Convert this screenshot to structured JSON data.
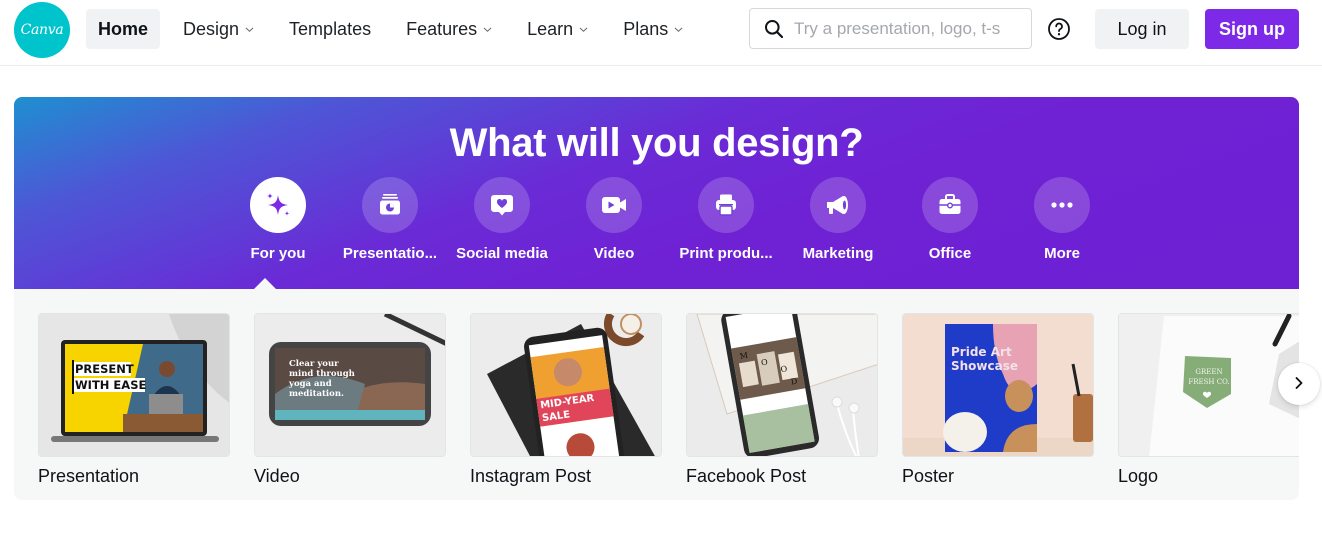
{
  "header": {
    "logo_text": "Canva",
    "nav": [
      {
        "label": "Home",
        "active": true,
        "dropdown": false
      },
      {
        "label": "Design",
        "active": false,
        "dropdown": true
      },
      {
        "label": "Templates",
        "active": false,
        "dropdown": false
      },
      {
        "label": "Features",
        "active": false,
        "dropdown": true
      },
      {
        "label": "Learn",
        "active": false,
        "dropdown": true
      },
      {
        "label": "Plans",
        "active": false,
        "dropdown": true
      }
    ],
    "search": {
      "placeholder": "Try a presentation, logo, t-s",
      "value": "",
      "icon": "search-icon"
    },
    "help_icon": "help-circle-icon",
    "login_label": "Log in",
    "signup_label": "Sign up"
  },
  "hero": {
    "title": "What will you design?",
    "categories": [
      {
        "label": "For you",
        "icon": "sparkles-icon",
        "active": true
      },
      {
        "label": "Presentatio...",
        "icon": "presentation-icon",
        "active": false
      },
      {
        "label": "Social media",
        "icon": "heart-bubble-icon",
        "active": false
      },
      {
        "label": "Video",
        "icon": "video-camera-icon",
        "active": false
      },
      {
        "label": "Print produ...",
        "icon": "printer-icon",
        "active": false
      },
      {
        "label": "Marketing",
        "icon": "megaphone-icon",
        "active": false
      },
      {
        "label": "Office",
        "icon": "briefcase-icon",
        "active": false
      },
      {
        "label": "More",
        "icon": "more-dots-icon",
        "active": false
      }
    ]
  },
  "cards": [
    {
      "label": "Presentation",
      "thumb_text": [
        "PRESENT",
        "WITH EASE"
      ]
    },
    {
      "label": "Video",
      "thumb_text": [
        "Clear your",
        "mind through",
        "yoga and",
        "meditation."
      ]
    },
    {
      "label": "Instagram Post",
      "thumb_text": [
        "MID-YEAR",
        "SALE"
      ]
    },
    {
      "label": "Facebook Post",
      "thumb_text": [
        "M",
        "O",
        "O",
        "D"
      ]
    },
    {
      "label": "Poster",
      "thumb_text": [
        "Pride Art",
        "Showcase"
      ]
    },
    {
      "label": "Logo",
      "thumb_text": [
        "GREEN",
        "FRESH CO."
      ]
    }
  ],
  "next_icon": "chevron-right-icon",
  "colors": {
    "brand_teal": "#00c4cc",
    "brand_purple": "#7d2ae8",
    "hero_start": "#1e90d0",
    "hero_end": "#6e20d3",
    "panel_bg": "#f6f7f7"
  }
}
